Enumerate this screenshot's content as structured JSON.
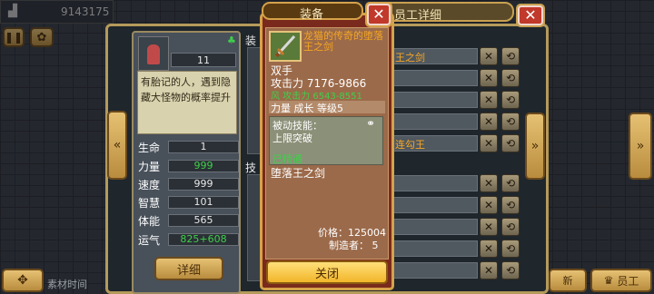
{
  "topbar": {
    "gold": "9143175"
  },
  "dialog": {
    "title": "员工详细"
  },
  "character": {
    "level": "11",
    "description": "有胎记的人，遇到隐藏大怪物的概率提升",
    "stats": [
      {
        "label": "生命",
        "value": "1"
      },
      {
        "label": "力量",
        "value": "999"
      },
      {
        "label": "速度",
        "value": "999"
      },
      {
        "label": "智慧",
        "value": "101"
      },
      {
        "label": "体能",
        "value": "565"
      },
      {
        "label": "运气",
        "value": "825+608"
      }
    ],
    "detail_button": "详细"
  },
  "section_labels": {
    "equip": "装",
    "skill": "技"
  },
  "list_rows": [
    {
      "text": "王之剑"
    },
    {
      "text": ""
    },
    {
      "text": ""
    },
    {
      "text": ""
    },
    {
      "text": "连勾王"
    },
    {
      "text": ""
    },
    {
      "text": ""
    },
    {
      "text": ""
    },
    {
      "text": ""
    },
    {
      "text": ""
    }
  ],
  "equip_popup": {
    "tab_label": "装备",
    "name": "龙猫的传奇的堕落王之剑",
    "type": "双手",
    "attack": "攻击力  7176-9866",
    "wind_attack": "风  攻击力  6543-8551",
    "growth": "力量  成长  等级5",
    "passive_title": "被动技能：",
    "passive": "上限突破",
    "mastered": "已精通",
    "item_name": "堕落王之剑",
    "price": "价格：125004",
    "maker": "制造者：  5",
    "close_button": "关闭"
  },
  "bottom": {
    "left_text": "素材时间",
    "right_text": "新",
    "staff_button": "员工"
  },
  "colors": {
    "gold": "#d5a24a",
    "popup_bg": "#7a2a1c",
    "name_orange": "#f5a623",
    "green": "#3fcf4a"
  }
}
